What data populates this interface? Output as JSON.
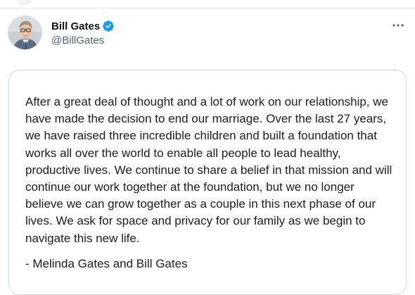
{
  "tweet": {
    "author": {
      "display_name": "Bill Gates",
      "handle": "@BillGates",
      "verified": true,
      "avatar_icon": "profile-photo"
    },
    "more_icon": "ellipsis-icon",
    "colors": {
      "verified_badge": "#1d9bf0",
      "secondary_text": "#536471",
      "card_border": "#cfd9de"
    },
    "image": {
      "statement": "After a great deal of thought and a lot of work on our relationship, we have made the decision to end our marriage. Over the last 27 years, we have raised three incredible children and built a foundation that works all over the world to enable all people to lead healthy, productive lives. We continue to share a belief in that mission and will continue our work together at the foundation, but we no longer believe we can grow together as a couple in this next phase of our lives. We ask for space and privacy for our family as we begin to navigate this new life.",
      "signature": "- Melinda Gates and Bill Gates"
    }
  }
}
